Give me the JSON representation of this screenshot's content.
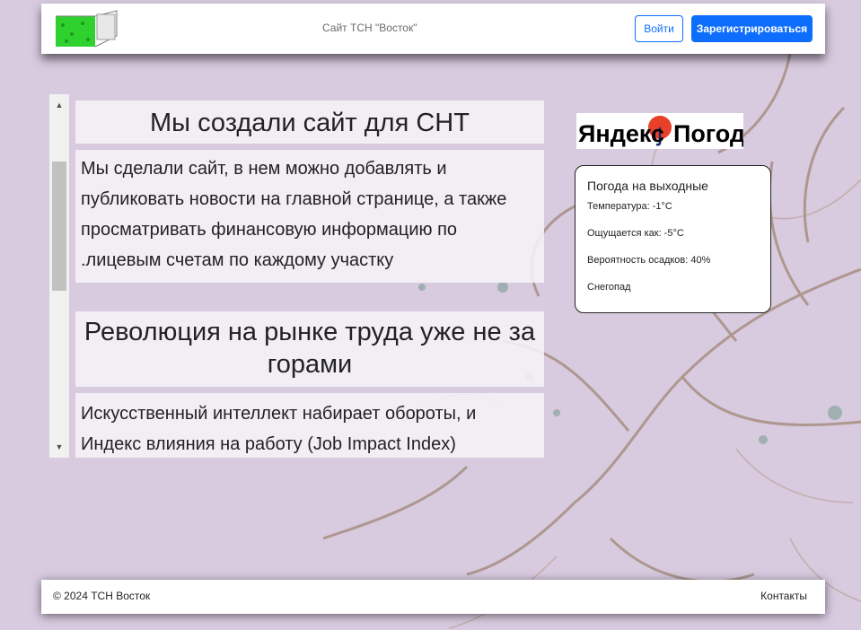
{
  "header": {
    "site_title": "Сайт ТСН \"Восток\"",
    "login_label": "Войти",
    "register_label": "Зарегистрироваться"
  },
  "posts": [
    {
      "title": "Мы создали сайт для СНТ",
      "body": "Мы сделали сайт, в нем можно добавлять и публиковать новости на главной странице, а также просматривать финансовую информацию по .лицевым счетам по каждому участку"
    },
    {
      "title": "Революция на рынке труда уже не за горами",
      "body": "Искусственный интеллект набирает обороты, и Индекс влияния на работу (Job Impact Index)"
    }
  ],
  "weather": {
    "logo_left": "Яндекс",
    "logo_right": "Погода",
    "title": "Погода на выходные",
    "temperature": "Температура: -1°C",
    "feels_like": "Ощущается как: -5°C",
    "precipitation": "Вероятность осадков: 40%",
    "condition": "Снегопад"
  },
  "footer": {
    "copyright": "© 2024 ТСН Восток",
    "contacts_label": "Контакты"
  }
}
